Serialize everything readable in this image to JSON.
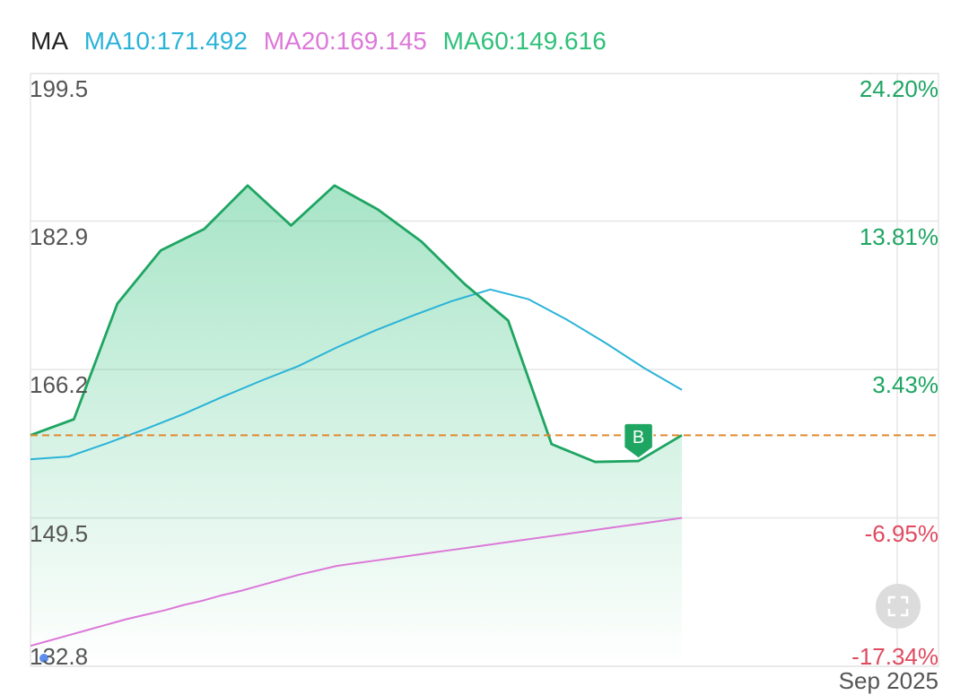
{
  "legend": {
    "label": "MA",
    "ma10": "MA10:171.492",
    "ma20": "MA20:169.145",
    "ma60": "MA60:149.616"
  },
  "colors": {
    "price": "#1ea562",
    "ma10": "#2ab3d8",
    "ma20": "#dc78d8",
    "ma60": "#2fc07a",
    "reference": "#e08a2e",
    "positive": "#1ea562",
    "negative": "#e04a5f",
    "axis_text": "#555555",
    "grid": "#e6e6e6"
  },
  "chart_data": {
    "type": "area",
    "y_ticks": [
      "199.5",
      "182.9",
      "166.2",
      "149.5",
      "132.8"
    ],
    "y_tick_values": [
      199.5,
      182.9,
      166.2,
      149.5,
      132.8
    ],
    "pct_ticks": [
      "24.20%",
      "13.81%",
      "3.43%",
      "-6.95%",
      "-17.34%"
    ],
    "x_label": "Sep 2025",
    "ylim": [
      132.8,
      199.5
    ],
    "reference_value": 158.8,
    "series": [
      {
        "name": "price",
        "values": [
          158.8,
          160.6,
          173.6,
          179.6,
          182.0,
          186.9,
          182.4,
          186.9,
          184.2,
          180.6,
          175.8,
          171.7,
          157.8,
          155.8,
          155.9,
          158.8
        ]
      },
      {
        "name": "MA10",
        "values": [
          156.1,
          156.4,
          157.9,
          159.5,
          161.2,
          163.1,
          164.9,
          166.6,
          168.7,
          170.6,
          172.3,
          173.9,
          175.2,
          174.1,
          171.8,
          169.2,
          166.4,
          163.9
        ]
      },
      {
        "name": "MA20",
        "values": [
          135.1,
          135.7,
          136.3,
          136.9,
          137.5,
          138.1,
          138.6,
          139.1,
          139.7,
          140.2,
          140.8,
          141.3,
          141.9,
          142.5,
          143.1,
          143.6,
          144.1,
          144.4,
          144.7,
          145.0,
          145.3,
          145.6,
          145.9,
          146.2,
          146.5,
          146.8,
          147.1,
          147.4,
          147.7,
          148.0,
          148.3,
          148.6,
          148.9,
          149.2,
          149.5
        ]
      }
    ],
    "buy_marker": {
      "label": "B",
      "value": 155.9
    }
  }
}
